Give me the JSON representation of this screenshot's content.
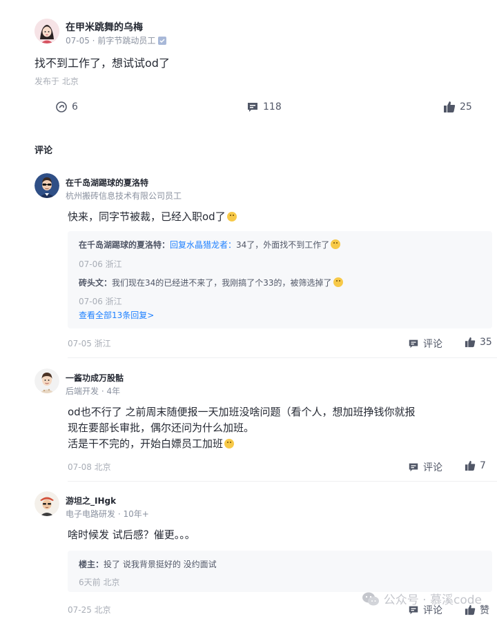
{
  "post": {
    "author": "在甲米跳舞的乌梅",
    "date_title": "07-05 · 前字节跳动员工",
    "content": "找不到工作了，想试试od了",
    "location": "发布于 北京",
    "shares": "6",
    "comments": "118",
    "likes": "25"
  },
  "comments_section": {
    "title": "评论",
    "comment_label": "评论",
    "like_label": "赞"
  },
  "comments": [
    {
      "author": "在千岛湖踢球的夏洛特",
      "title": "杭州搬砖信息技术有限公司员工",
      "text": "快来，同字节被裁，已经入职od了",
      "date": "07-05 浙江",
      "likes": "35",
      "replies": [
        {
          "author": "在千岛湖踢球的夏洛特：",
          "reply_to": "回复水晶猎龙者：",
          "text": "34了，外面找不到工作了",
          "date": "07-06 浙江"
        },
        {
          "author": "砖头文：",
          "text": "我们现在34的已经进不来了，我刚搞了个33的，被筛选掉了",
          "date": "07-06 浙江"
        }
      ],
      "view_all": "查看全部13条回复>"
    },
    {
      "author": "一酱功成万股骷",
      "title": "后端开发 · 4年",
      "text_lines": [
        "od也不行了 之前周末随便报一天加班没啥问题（看个人，想加班挣钱你就报",
        "现在要部长审批，偶尔还问为什么加班。",
        "活是干不完的，开始白嫖员工加班"
      ],
      "date": "07-08 北京",
      "likes": "7"
    },
    {
      "author": "游坦之_IHgk",
      "title": "电子电路研发 · 10年+",
      "text": "啥时候发 试后感？催更。。。",
      "reply": {
        "author": "楼主：",
        "text": "投了 说我背景挺好的 没约面试",
        "date": "6天前 北京"
      },
      "date": "07-25 北京"
    }
  ],
  "watermark": {
    "label": "公众号 · 慕溪code"
  },
  "colors": {
    "link": "#1e80ff",
    "text": "#252933",
    "muted": "#8a919f",
    "reply_bg": "#f7f8fa"
  }
}
